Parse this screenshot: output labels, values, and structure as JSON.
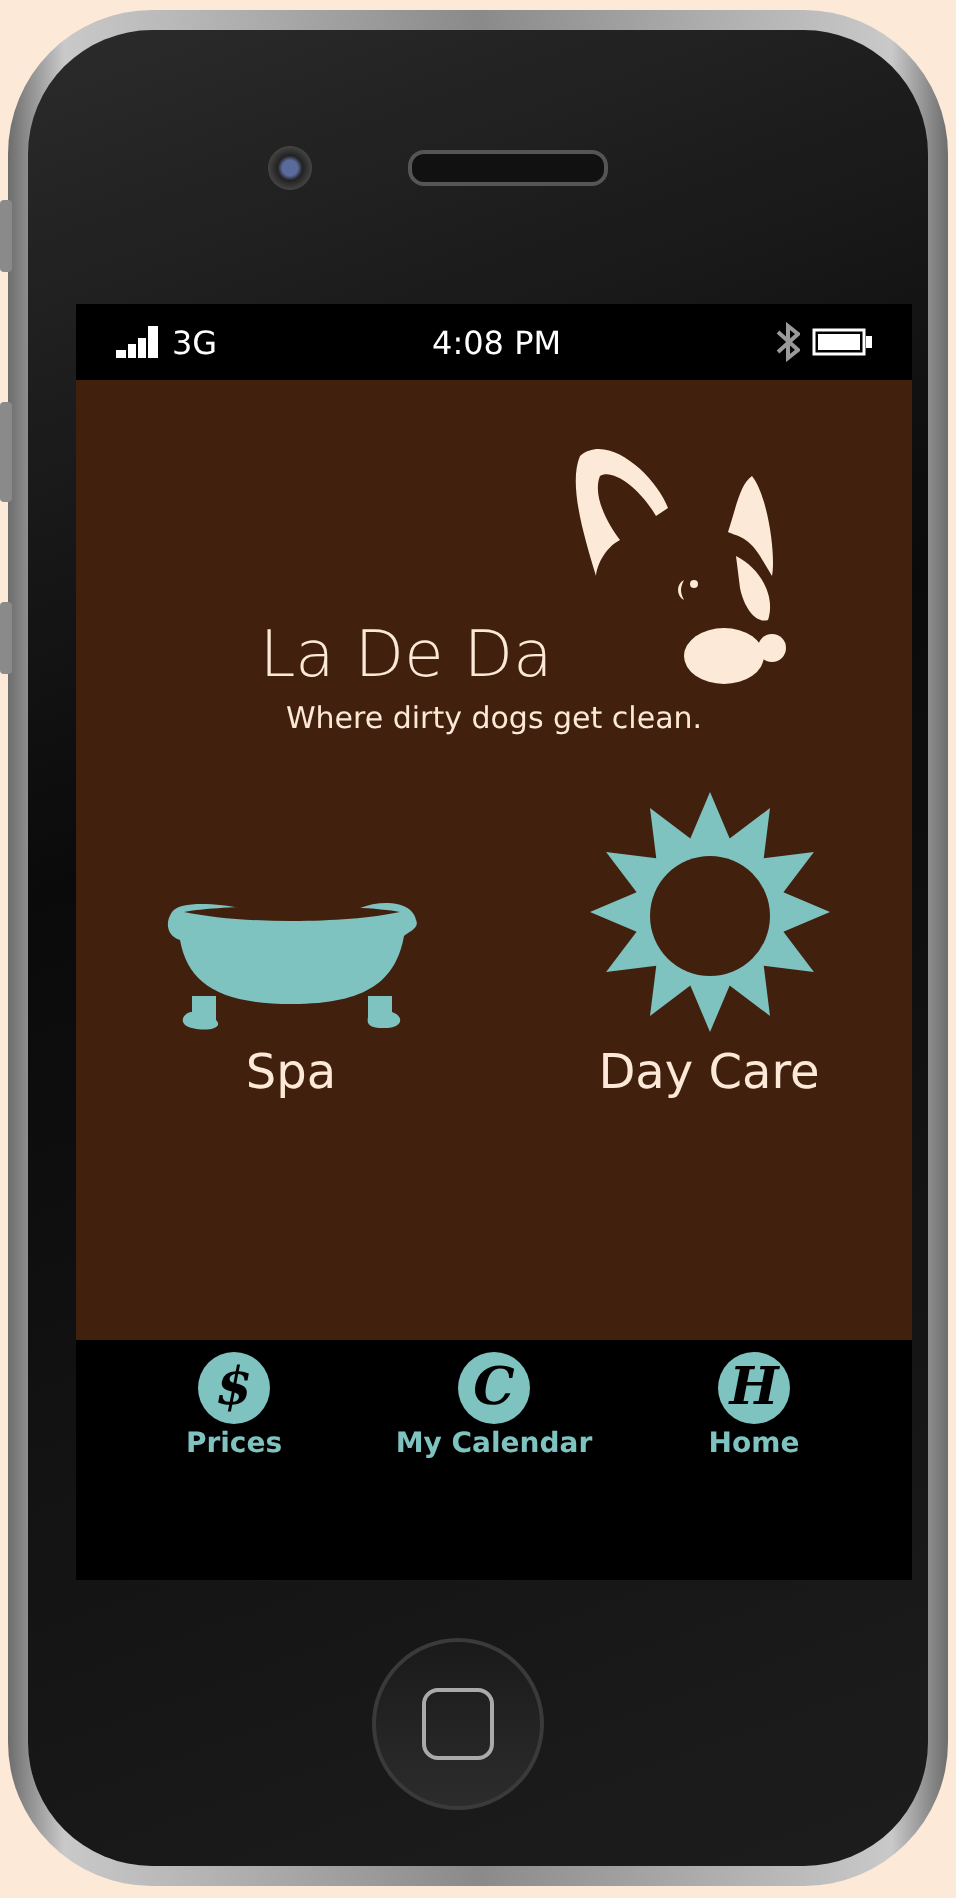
{
  "status_bar": {
    "network": "3G",
    "time": "4:08 PM"
  },
  "brand": {
    "name": "La De Da",
    "tagline": "Where dirty dogs get clean."
  },
  "services": [
    {
      "kind": "tub",
      "label": "Spa"
    },
    {
      "kind": "sun",
      "label": "Day Care"
    }
  ],
  "tab_bar": [
    {
      "glyph": "$",
      "label": "Prices"
    },
    {
      "glyph": "C",
      "label": "My Calendar"
    },
    {
      "glyph": "H",
      "label": "Home"
    }
  ]
}
